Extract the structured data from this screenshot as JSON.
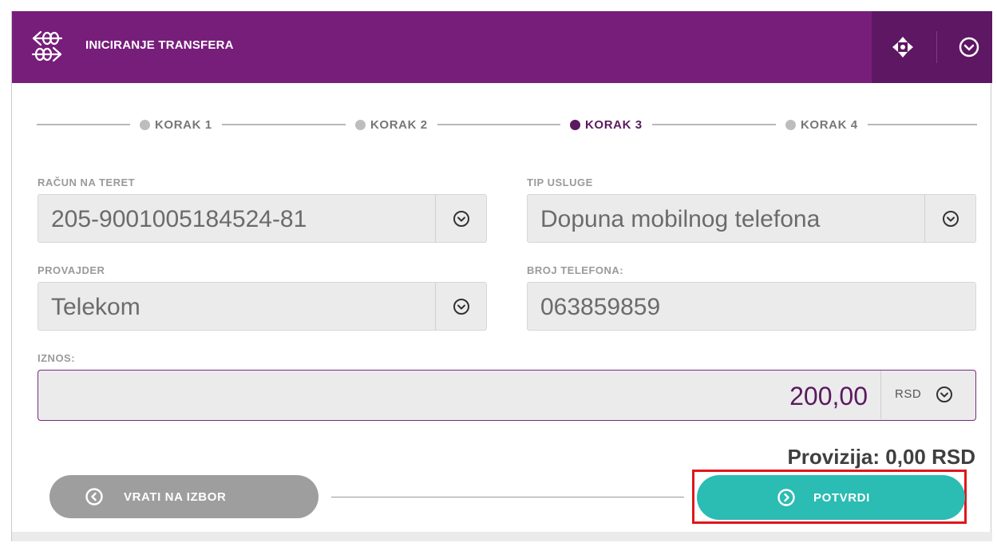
{
  "header": {
    "title": "INICIRANJE TRANSFERA",
    "logo_icon": "transfer-arrows-icon",
    "move_icon": "move-icon",
    "collapse_icon": "chevron-down-circle-icon",
    "color": "#771e7b"
  },
  "steps": [
    {
      "label": "KORAK 1",
      "active": false
    },
    {
      "label": "KORAK 2",
      "active": false
    },
    {
      "label": "KORAK 3",
      "active": true
    },
    {
      "label": "KORAK 4",
      "active": false
    }
  ],
  "form": {
    "account": {
      "label": "RAČUN NA TERET",
      "value": "205-9001005184524-81"
    },
    "service_type": {
      "label": "TIP USLUGE",
      "value": "Dopuna mobilnog telefona"
    },
    "provider": {
      "label": "PROVAJDER",
      "value": "Telekom"
    },
    "phone": {
      "label": "BROJ TELEFONA:",
      "value": "063859859"
    },
    "amount": {
      "label": "IZNOS:",
      "value": "200,00",
      "currency": "RSD"
    }
  },
  "fee": "Provizija: 0,00 RSD",
  "buttons": {
    "back": "VRATI NA IZBOR",
    "confirm": "POTVRDI"
  },
  "colors": {
    "accent": "#5b1a60",
    "confirm": "#2bbcb3",
    "back": "#9e9e9e",
    "highlight": "#e0161b"
  }
}
